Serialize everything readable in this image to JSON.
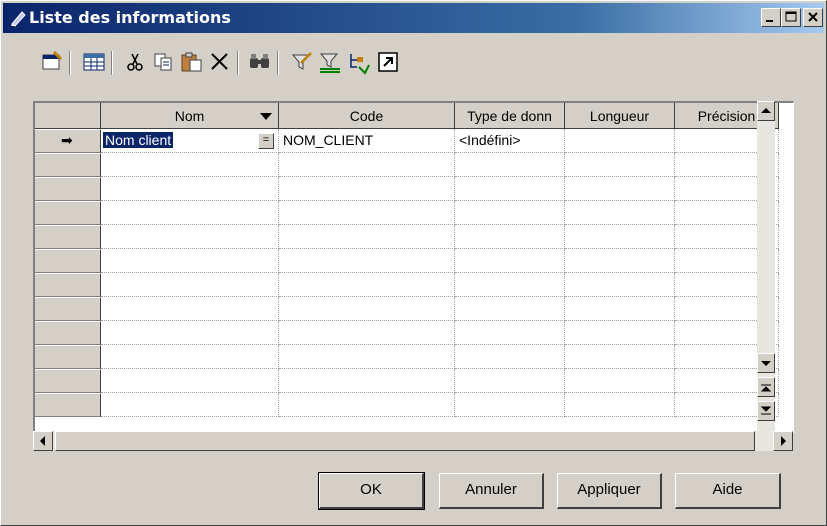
{
  "window": {
    "title": "Liste des informations",
    "controls": [
      "minimize",
      "maximize",
      "close"
    ]
  },
  "toolbar": {
    "icons": [
      "properties-icon",
      "table-icon",
      "cut-icon",
      "copy-icon",
      "paste-icon",
      "delete-icon",
      "find-icon",
      "filter-icon",
      "clear-filter-icon",
      "hierarchy-icon",
      "open-icon"
    ]
  },
  "grid": {
    "columns": [
      "Nom",
      "Code",
      "Type de donn",
      "Longueur",
      "Précision"
    ],
    "rows": [
      {
        "nom": "Nom client",
        "code": "NOM_CLIENT",
        "type": "<Indéfini>",
        "longueur": "",
        "precision": ""
      }
    ],
    "current_row_marker": "➡",
    "empty_rows": 11
  },
  "buttons": {
    "ok": "OK",
    "cancel": "Annuler",
    "apply": "Appliquer",
    "help": "Aide"
  },
  "colors": {
    "title_gradient_start": "#0a246a",
    "title_gradient_end": "#a6caf0",
    "selection": "#0a246a"
  }
}
